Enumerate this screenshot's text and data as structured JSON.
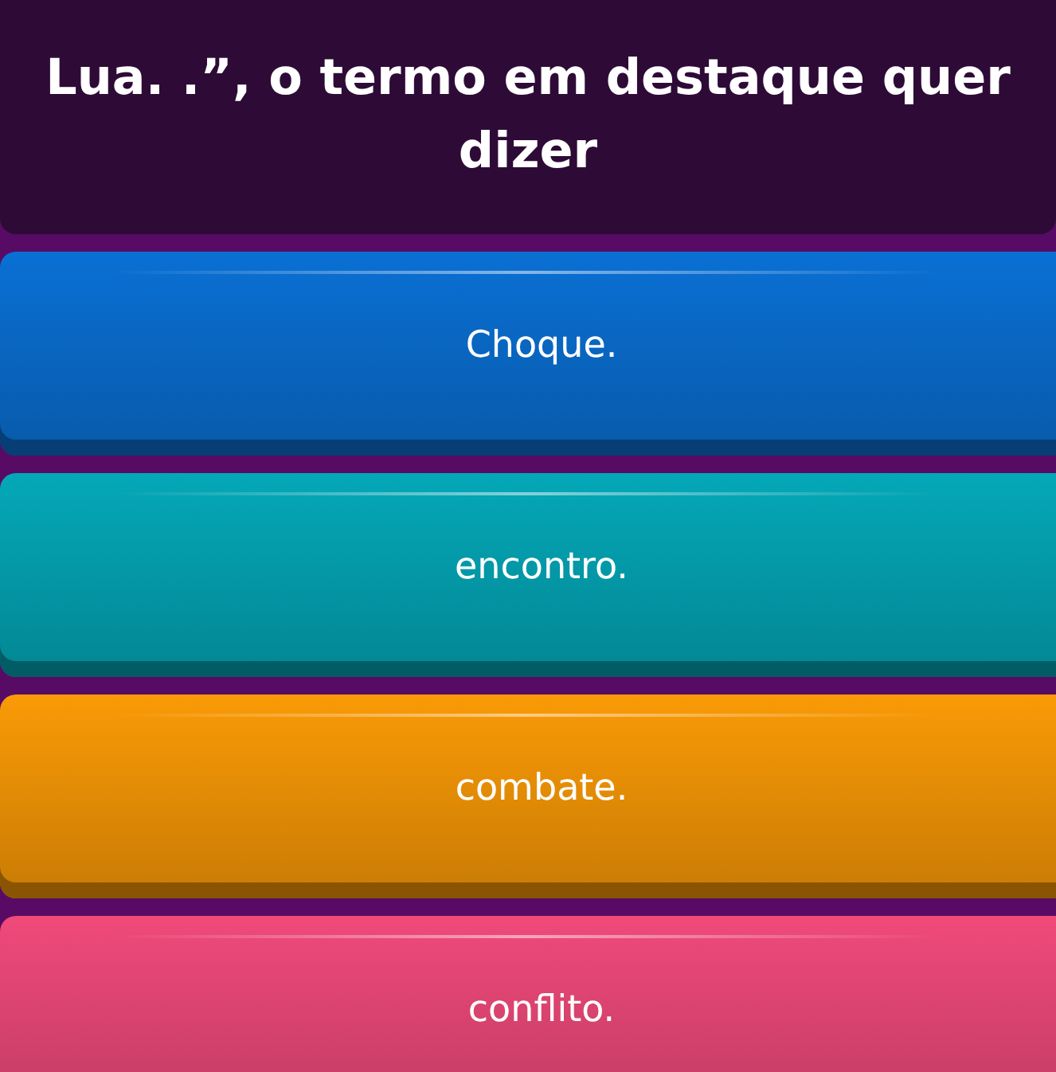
{
  "question": {
    "text": "Lua. .”, o termo em destaque quer dizer"
  },
  "options": [
    {
      "label": "Choque.",
      "color": "#0a70d4"
    },
    {
      "label": "encontro.",
      "color": "#04a8b8"
    },
    {
      "label": "combate.",
      "color": "#fa9a06"
    },
    {
      "label": "conflito.",
      "color": "#f04a7a"
    }
  ]
}
